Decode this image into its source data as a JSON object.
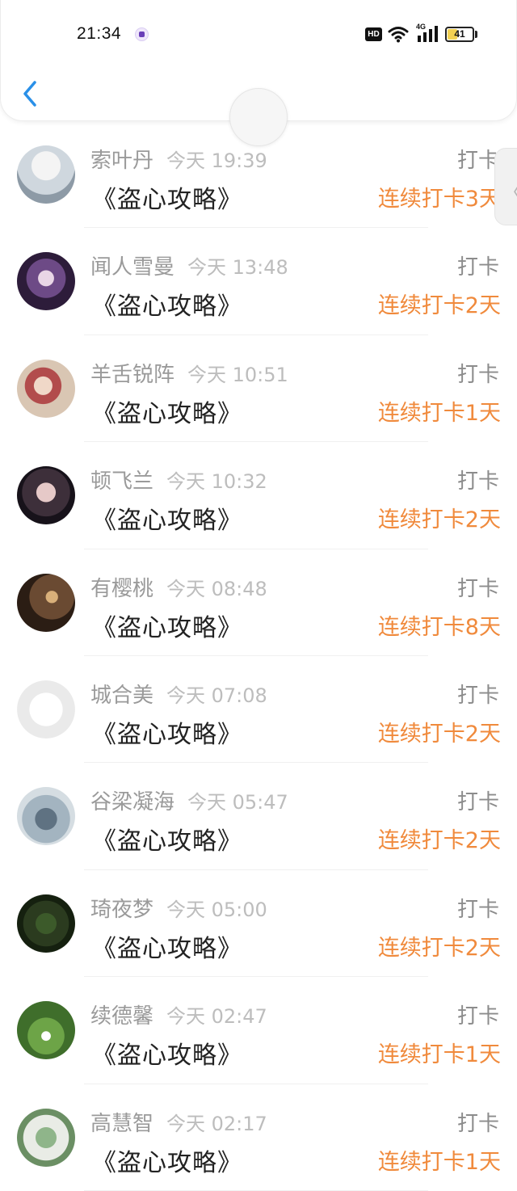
{
  "status_bar": {
    "time": "21:34",
    "hd_label": "HD",
    "network_label": "4G",
    "battery_level": "41",
    "battery_fraction": 0.41
  },
  "nav": {
    "back_icon": "chevron-left-icon",
    "accent_color": "#2a90e8"
  },
  "side_handle": {
    "icon": "chevron-left-icon",
    "glyph": "〈"
  },
  "colors": {
    "name": "#9a9a9a",
    "time": "#bdbdbd",
    "book": "#222222",
    "streak": "#f08a3c"
  },
  "checkins": [
    {
      "name": "索叶丹",
      "time": "今天 19:39",
      "type": "打卡",
      "book": "《盗心攻略》",
      "streak": "连续打卡3天"
    },
    {
      "name": "闻人雪曼",
      "time": "今天 13:48",
      "type": "打卡",
      "book": "《盗心攻略》",
      "streak": "连续打卡2天"
    },
    {
      "name": "羊舌锐阵",
      "time": "今天 10:51",
      "type": "打卡",
      "book": "《盗心攻略》",
      "streak": "连续打卡1天"
    },
    {
      "name": "顿飞兰",
      "time": "今天 10:32",
      "type": "打卡",
      "book": "《盗心攻略》",
      "streak": "连续打卡2天"
    },
    {
      "name": "有樱桃",
      "time": "今天 08:48",
      "type": "打卡",
      "book": "《盗心攻略》",
      "streak": "连续打卡8天"
    },
    {
      "name": "城合美",
      "time": "今天 07:08",
      "type": "打卡",
      "book": "《盗心攻略》",
      "streak": "连续打卡2天"
    },
    {
      "name": "谷梁凝海",
      "time": "今天 05:47",
      "type": "打卡",
      "book": "《盗心攻略》",
      "streak": "连续打卡2天"
    },
    {
      "name": "琦夜梦",
      "time": "今天 05:00",
      "type": "打卡",
      "book": "《盗心攻略》",
      "streak": "连续打卡2天"
    },
    {
      "name": "续德馨",
      "time": "今天 02:47",
      "type": "打卡",
      "book": "《盗心攻略》",
      "streak": "连续打卡1天"
    },
    {
      "name": "高慧智",
      "time": "今天 02:17",
      "type": "打卡",
      "book": "《盗心攻略》",
      "streak": "连续打卡1天"
    }
  ]
}
